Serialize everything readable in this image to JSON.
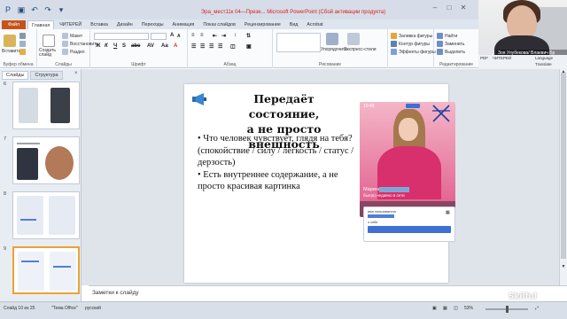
{
  "window": {
    "title": "Эра_мест11к 04—Презе... Microsoft PowerPoint (Сбой активации продукта)"
  },
  "ribbon_tabs": [
    "Файл",
    "Главная",
    "ЧИТЕРЕЙ",
    "Вставка",
    "Дизайн",
    "Переходы",
    "Анимация",
    "Показ слайдов",
    "Рецензирование",
    "Вид",
    "Acrobat"
  ],
  "ribbon": {
    "paste_label": "Вставить",
    "cut_label": "Вырезать",
    "copy_label": "Копировать",
    "format_painter_label": "Формат по образцу",
    "new_slide_label": "Создать слайд",
    "layout_label": "Макет",
    "reset_label": "Восстановить",
    "section_label": "Раздел",
    "font_combo": "",
    "size_combo": "",
    "arrange_label": "Упорядочить",
    "quick_styles_label": "Экспресс-стили",
    "shape_fill_label": "Заливка фигуры",
    "shape_outline_label": "Контур фигуры",
    "shape_effects_label": "Эффекты фигуры",
    "find_label": "Найти",
    "replace_label": "Заменить",
    "select_label": "Выделить",
    "groups": [
      "Буфер обмена",
      "Слайды",
      "Шрифт",
      "Абзац",
      "Рисование",
      "Редактирование"
    ]
  },
  "webcam": {
    "caption": "Зоя Улубекова/ Влаевич Бр",
    "lower_labels": [
      "PDF",
      "ЧИТЕРЕЙ",
      "Language"
    ],
    "translate_label": "Translate"
  },
  "left_panel": {
    "tabs": [
      "Слайды",
      "Структура"
    ],
    "close": "×",
    "slide_numbers": [
      "6",
      "7",
      "8",
      "9"
    ]
  },
  "slide": {
    "title_line1": "Передаёт состояние,",
    "title_line2": "а не просто внешность",
    "bullet1": "• Что человек чувствует, глядя на тебя? (спокойствие / силу / лёгкость / статус / дерзость)",
    "bullet2": "• Есть внутреннее содержание, а не просто красивая картинка",
    "phone": {
      "time": "10:49",
      "name": "Марина",
      "subtitle": "был(а) недавно в сети",
      "toolbar": [
        "☎",
        "▶",
        "♫",
        "…",
        "✕"
      ]
    },
    "card": {
      "label1": "имя пользователя",
      "label2": "о себе"
    }
  },
  "notes": {
    "placeholder": "Заметки к слайду"
  },
  "status": {
    "slide_counter": "Слайд 10 из 25",
    "theme": "\"Тема Office\"",
    "language": "русский",
    "zoom": "53%"
  },
  "watermark": "Skilful",
  "colors": {
    "file_tab": "#c7531b",
    "accent_blue": "#4f7fd6",
    "selected_thumb": "#f0a030"
  }
}
